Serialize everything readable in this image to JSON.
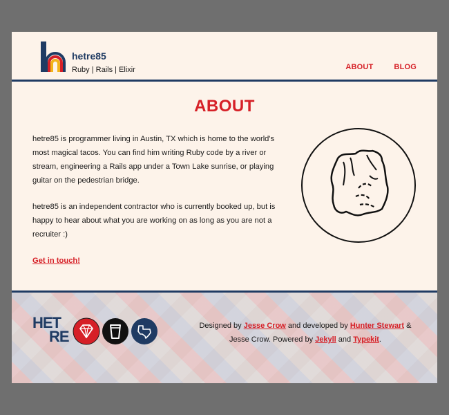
{
  "header": {
    "site_name": "hetre85",
    "tagline": "Ruby | Rails | Elixir",
    "nav": [
      {
        "label": "ABOUT"
      },
      {
        "label": "BLOG"
      }
    ]
  },
  "main": {
    "title": "ABOUT",
    "paragraph_1": "hetre85 is programmer living in Austin, TX which is home to the world's most magical tacos. You can find him writing Ruby code by a river or stream, engineering a Rails app under a Town Lake sunrise, or playing guitar on the pedestrian bridge.",
    "paragraph_2": "hetre85 is an independent contractor who is currently booked up, but is happy to hear about what you are working on as long as you are not a recruiter :)",
    "cta": "Get in touch!"
  },
  "footer": {
    "logo_top": "HET",
    "logo_bottom": "RE",
    "designed_by": "Designed by",
    "designer": "Jesse Crow",
    "developed_by": "and developed by",
    "developer": "Hunter Stewart",
    "amp": "&",
    "line2_prefix": "Jesse Crow. Powered by",
    "tech_1": "Jekyll",
    "and": "and",
    "tech_2": "Typekit",
    "period": "."
  },
  "colors": {
    "accent_red": "#d62027",
    "navy": "#1f3b63",
    "cream": "#fdf3ea"
  },
  "icons": [
    "logo-h-icon",
    "ruby-gem-icon",
    "beer-glass-icon",
    "texas-icon"
  ]
}
